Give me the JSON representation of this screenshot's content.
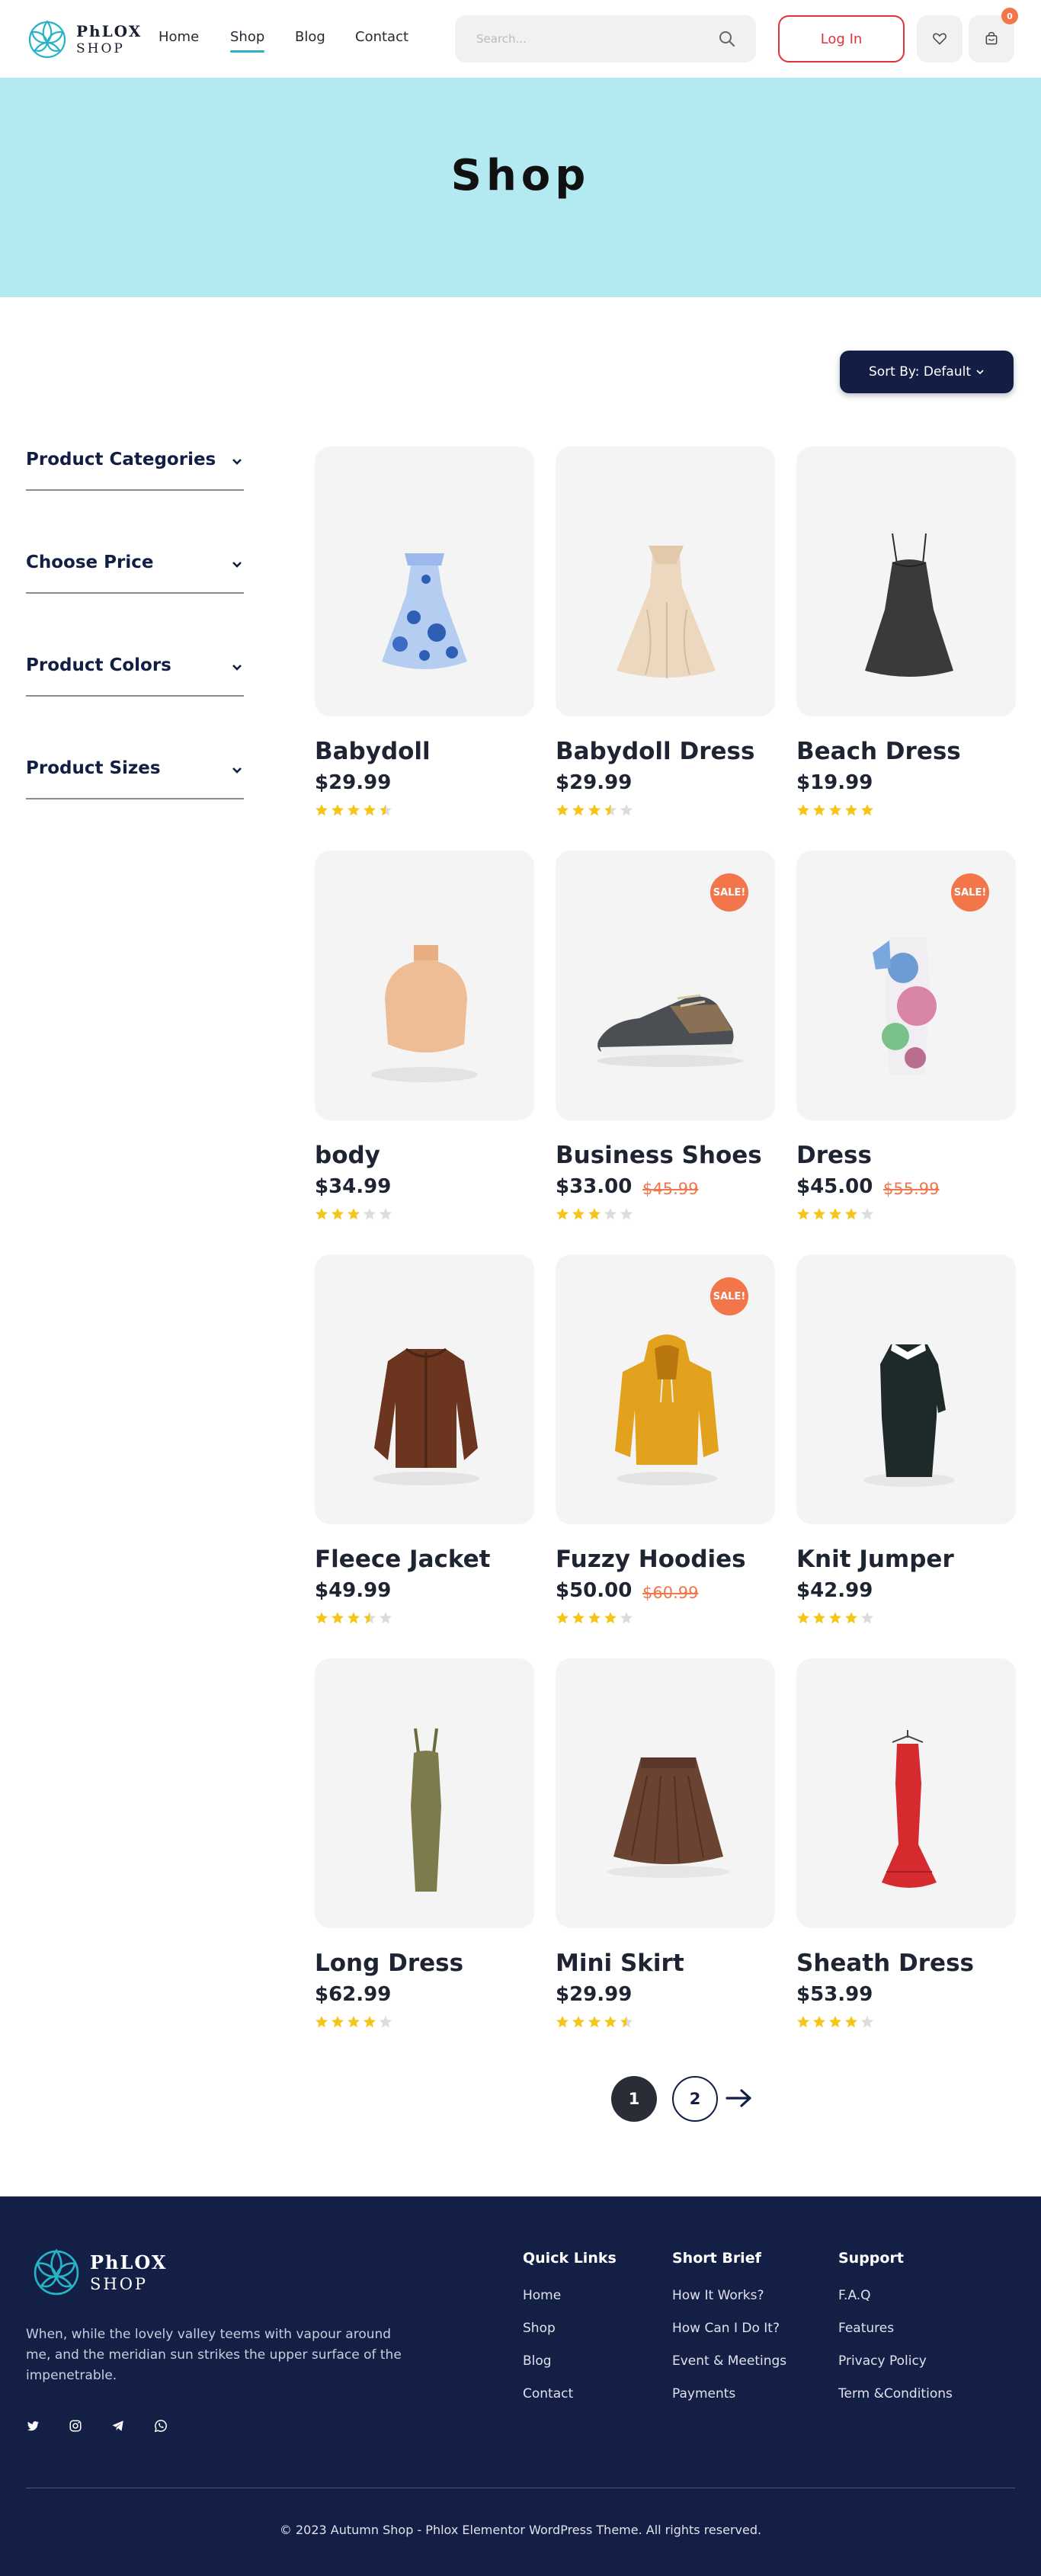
{
  "brand": {
    "line1": "PhLOX",
    "line2": "SHOP",
    "accent": "#27b3c6"
  },
  "nav": [
    {
      "label": "Home",
      "active": false
    },
    {
      "label": "Shop",
      "active": true
    },
    {
      "label": "Blog",
      "active": false
    },
    {
      "label": "Contact",
      "active": false
    }
  ],
  "search": {
    "placeholder": "Search...",
    "icon": "search-icon"
  },
  "header_actions": {
    "login_label": "Log In",
    "wishlist_icon": "heart-icon",
    "cart_icon": "cart-icon",
    "cart_count": "0"
  },
  "hero": {
    "title": "Shop",
    "bg": "#b3eaf2"
  },
  "sort": {
    "label": "Sort By: Default"
  },
  "filters": [
    "Product Categories",
    "Choose Price",
    "Product Colors",
    "Product Sizes"
  ],
  "products": [
    {
      "name": "Babydoll",
      "price": "$29.99",
      "old_price": "",
      "sale": false,
      "rating": 4.5,
      "image": "blue polka-dot dress"
    },
    {
      "name": "Babydoll Dress",
      "price": "$29.99",
      "old_price": "",
      "sale": false,
      "rating": 3.5,
      "image": "cream gown"
    },
    {
      "name": "Beach Dress",
      "price": "$19.99",
      "old_price": "",
      "sale": false,
      "rating": 5,
      "image": "black slip dress"
    },
    {
      "name": "body",
      "price": "$34.99",
      "old_price": "",
      "sale": false,
      "rating": 3,
      "image": "beige turtleneck bodysuit"
    },
    {
      "name": "Business Shoes",
      "price": "$33.00",
      "old_price": "$45.99",
      "sale": true,
      "rating": 3,
      "image": "black and brown shoe"
    },
    {
      "name": "Dress",
      "price": "$45.00",
      "old_price": "$55.99",
      "sale": true,
      "rating": 4,
      "image": "floral print dress"
    },
    {
      "name": "Fleece Jacket",
      "price": "$49.99",
      "old_price": "",
      "sale": false,
      "rating": 3.5,
      "image": "brown knit jacket"
    },
    {
      "name": "Fuzzy Hoodies",
      "price": "$50.00",
      "old_price": "$60.99",
      "sale": true,
      "rating": 4,
      "image": "yellow hoodie"
    },
    {
      "name": "Knit Jumper",
      "price": "$42.99",
      "old_price": "",
      "sale": false,
      "rating": 4,
      "image": "black knit dress with white collar"
    },
    {
      "name": "Long Dress",
      "price": "$62.99",
      "old_price": "",
      "sale": false,
      "rating": 4,
      "image": "olive long dress"
    },
    {
      "name": "Mini Skirt",
      "price": "$29.99",
      "old_price": "",
      "sale": false,
      "rating": 4.5,
      "image": "brown pleated skirt"
    },
    {
      "name": "Sheath Dress",
      "price": "$53.99",
      "old_price": "",
      "sale": false,
      "rating": 4,
      "image": "red mermaid dress on hanger"
    }
  ],
  "sale_label": "SALE!",
  "pagination": {
    "pages": [
      "1",
      "2"
    ],
    "current": "1",
    "next_icon": "arrow-right-icon"
  },
  "footer": {
    "about": "When, while the lovely valley teems with vapour around me, and the meridian sun strikes the upper surface of the impenetrable.",
    "social": [
      "twitter-icon",
      "instagram-icon",
      "telegram-icon",
      "whatsapp-icon"
    ],
    "columns": [
      {
        "title": "Quick Links",
        "links": [
          "Home",
          "Shop",
          "Blog",
          "Contact"
        ]
      },
      {
        "title": "Short Brief",
        "links": [
          "How It Works?",
          "How Can I Do It?",
          "Event & Meetings",
          "Payments"
        ]
      },
      {
        "title": "Support",
        "links": [
          "F.A.Q",
          "Features",
          "Privacy Policy",
          "Term &Conditions"
        ]
      }
    ],
    "copyright": "© 2023 Autumn Shop - Phlox Elementor WordPress Theme. All rights reserved."
  },
  "colors": {
    "navy": "#141f45",
    "sale": "#f3754a",
    "star": "#f5c518",
    "login": "#e0323c"
  }
}
